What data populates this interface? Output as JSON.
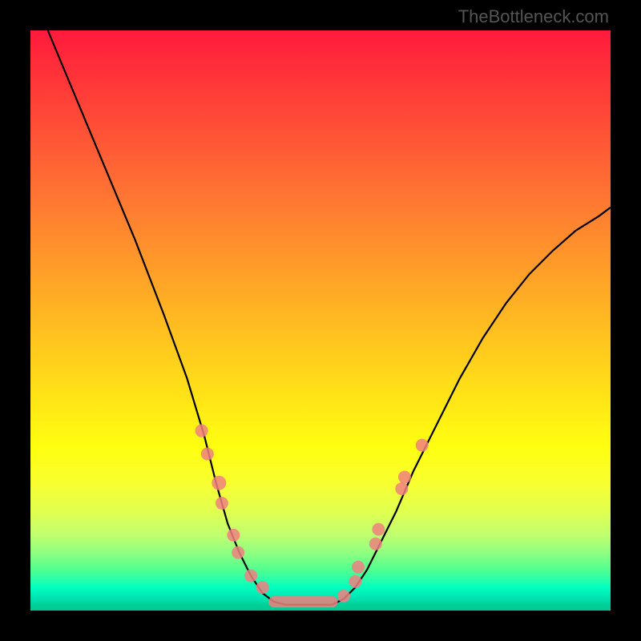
{
  "watermark": "TheBottleneck.com",
  "chart_data": {
    "type": "line",
    "title": "",
    "xlabel": "",
    "ylabel": "",
    "xlim": [
      0,
      100
    ],
    "ylim": [
      0,
      100
    ],
    "grid": false,
    "curve_segments": [
      {
        "name": "left-branch",
        "points": [
          [
            3,
            100
          ],
          [
            8,
            88
          ],
          [
            13,
            76
          ],
          [
            18,
            64
          ],
          [
            23,
            51
          ],
          [
            27,
            40
          ],
          [
            30,
            30
          ],
          [
            32,
            22
          ],
          [
            34,
            15
          ],
          [
            36,
            10
          ],
          [
            38,
            6
          ],
          [
            40,
            3
          ],
          [
            42,
            1.5
          ],
          [
            44,
            1
          ]
        ]
      },
      {
        "name": "flat",
        "points": [
          [
            44,
            1
          ],
          [
            52,
            1
          ]
        ]
      },
      {
        "name": "right-branch",
        "points": [
          [
            52,
            1
          ],
          [
            54,
            2
          ],
          [
            56,
            4
          ],
          [
            58,
            7
          ],
          [
            60,
            11
          ],
          [
            63,
            17
          ],
          [
            66,
            24
          ],
          [
            70,
            32
          ],
          [
            74,
            40
          ],
          [
            78,
            47
          ],
          [
            82,
            53
          ],
          [
            86,
            58
          ],
          [
            90,
            62
          ],
          [
            94,
            65.5
          ],
          [
            98,
            68
          ],
          [
            100,
            69.5
          ]
        ]
      }
    ],
    "points": [
      {
        "x": 29.5,
        "y": 31,
        "r": 8
      },
      {
        "x": 30.5,
        "y": 27,
        "r": 8
      },
      {
        "x": 32.5,
        "y": 22,
        "r": 9
      },
      {
        "x": 33,
        "y": 18.5,
        "r": 8
      },
      {
        "x": 35,
        "y": 13,
        "r": 8
      },
      {
        "x": 35.8,
        "y": 10,
        "r": 8
      },
      {
        "x": 38,
        "y": 6,
        "r": 8
      },
      {
        "x": 40,
        "y": 4,
        "r": 8
      },
      {
        "x": 54,
        "y": 2.5,
        "r": 8
      },
      {
        "x": 56,
        "y": 5,
        "r": 8
      },
      {
        "x": 56.5,
        "y": 7.5,
        "r": 8
      },
      {
        "x": 59.5,
        "y": 11.5,
        "r": 8
      },
      {
        "x": 60,
        "y": 14,
        "r": 8
      },
      {
        "x": 64,
        "y": 21,
        "r": 8
      },
      {
        "x": 64.5,
        "y": 23,
        "r": 8
      },
      {
        "x": 67.5,
        "y": 28.5,
        "r": 8
      }
    ],
    "flat_marker": {
      "x1": 42,
      "y1": 1.5,
      "x2": 52,
      "y2": 1.5
    }
  }
}
